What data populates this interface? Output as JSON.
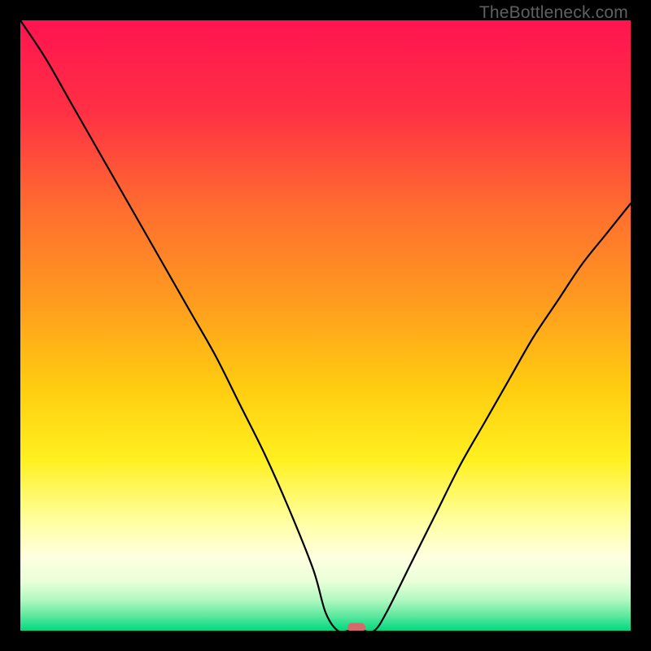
{
  "watermark": "TheBottleneck.com",
  "chart_data": {
    "type": "line",
    "title": "",
    "xlabel": "",
    "ylabel": "",
    "xlim": [
      0,
      100
    ],
    "ylim": [
      0,
      100
    ],
    "x": [
      0,
      4,
      8,
      12,
      16,
      20,
      24,
      28,
      32,
      36,
      40,
      44,
      48,
      50,
      52,
      54,
      56,
      58,
      60,
      64,
      68,
      72,
      76,
      80,
      84,
      88,
      92,
      96,
      100
    ],
    "values": [
      100,
      94,
      87,
      80,
      73,
      66,
      59,
      52,
      45,
      37,
      29,
      20,
      10,
      3,
      0,
      0,
      0,
      0,
      3,
      11,
      19,
      27,
      34,
      41,
      48,
      54,
      60,
      65,
      70
    ],
    "marker": {
      "x": 55,
      "y": 0,
      "color": "#d46a6a"
    },
    "gradient_stops": [
      {
        "offset": 0,
        "color": "#ff1450"
      },
      {
        "offset": 15,
        "color": "#ff3044"
      },
      {
        "offset": 30,
        "color": "#ff6a30"
      },
      {
        "offset": 45,
        "color": "#ff9820"
      },
      {
        "offset": 60,
        "color": "#ffcc10"
      },
      {
        "offset": 72,
        "color": "#fff020"
      },
      {
        "offset": 82,
        "color": "#ffffa0"
      },
      {
        "offset": 88,
        "color": "#ffffe0"
      },
      {
        "offset": 92,
        "color": "#e8ffd8"
      },
      {
        "offset": 95,
        "color": "#b0f8c0"
      },
      {
        "offset": 97.5,
        "color": "#60e8a0"
      },
      {
        "offset": 100,
        "color": "#00d880"
      }
    ]
  }
}
